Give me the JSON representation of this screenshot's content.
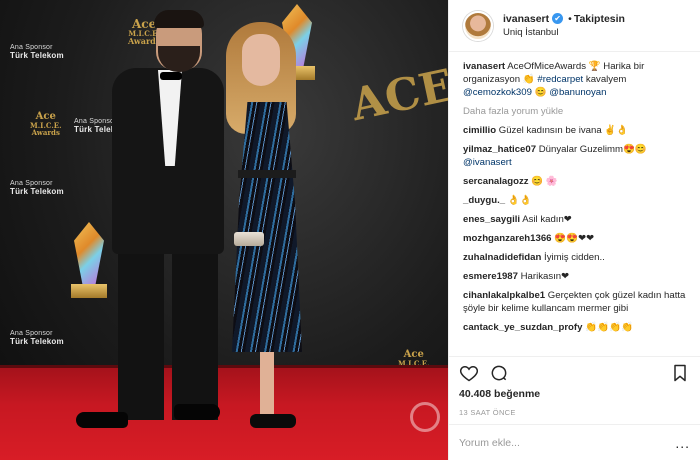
{
  "colors": {
    "link": "#003569",
    "verified": "#3897f0",
    "muted": "#999999",
    "carpet": "#c71822"
  },
  "photo": {
    "sponsor_small": "Ana Sponsor",
    "sponsor_brand": "Türk Telekom",
    "award_logo_top": "Ace",
    "award_logo_mid": "M.I.C.E.",
    "award_logo_bottom": "Awards",
    "big_letters": "ACE",
    "watermark": "b"
  },
  "header": {
    "username": "ivanasert",
    "verified_icon": "✔",
    "separator": "•",
    "follow_label": "Takiptesin",
    "location": "Uniq İstanbul"
  },
  "caption": {
    "user": "ivanasert",
    "text1": "AceOfMiceAwards 🏆 Harika bir organizasyon 👏",
    "hashtag": "#redcarpet",
    "text2": "kavalyem",
    "mention1": "@cemozkok309",
    "emoji": "😊",
    "mention2": "@banunoyan"
  },
  "load_more": "Daha fazla yorum yükle",
  "comments": [
    {
      "user": "cimillio",
      "text": "Güzel kadınsın be ivana ✌👌"
    },
    {
      "user": "yilmaz_hatice07",
      "text": "Dünyalar Guzelimm😍😊"
    },
    {
      "user": "",
      "text": "@ivanasert",
      "link": true
    },
    {
      "user": "sercanalagozz",
      "text": "😊 🌸"
    },
    {
      "user": "_duygu._",
      "text": "👌👌"
    },
    {
      "user": "enes_saygili",
      "text": "Asil kadın❤"
    },
    {
      "user": "mozhganzareh1366",
      "text": "😍😍❤❤"
    },
    {
      "user": "zuhalnadidefidan",
      "text": "İyimiş cidden.."
    },
    {
      "user": "esmere1987",
      "text": "Harikasın❤"
    },
    {
      "user": "cihanlakalpkalbe1",
      "text": "Gerçekten çok güzel kadın hatta şöyle bir kelime kullancam mermer gibi"
    },
    {
      "user": "cantack_ye_suzdan_profy",
      "text": "👏👏👏👏"
    }
  ],
  "actions": {
    "like_icon": "heart-icon",
    "comment_icon": "comment-icon",
    "save_icon": "bookmark-icon"
  },
  "likes": {
    "count": "40.408",
    "word": "beğenme"
  },
  "timestamp": "13 SAAT ÖNCE",
  "add_comment": {
    "placeholder": "Yorum ekle...",
    "more": "..."
  }
}
